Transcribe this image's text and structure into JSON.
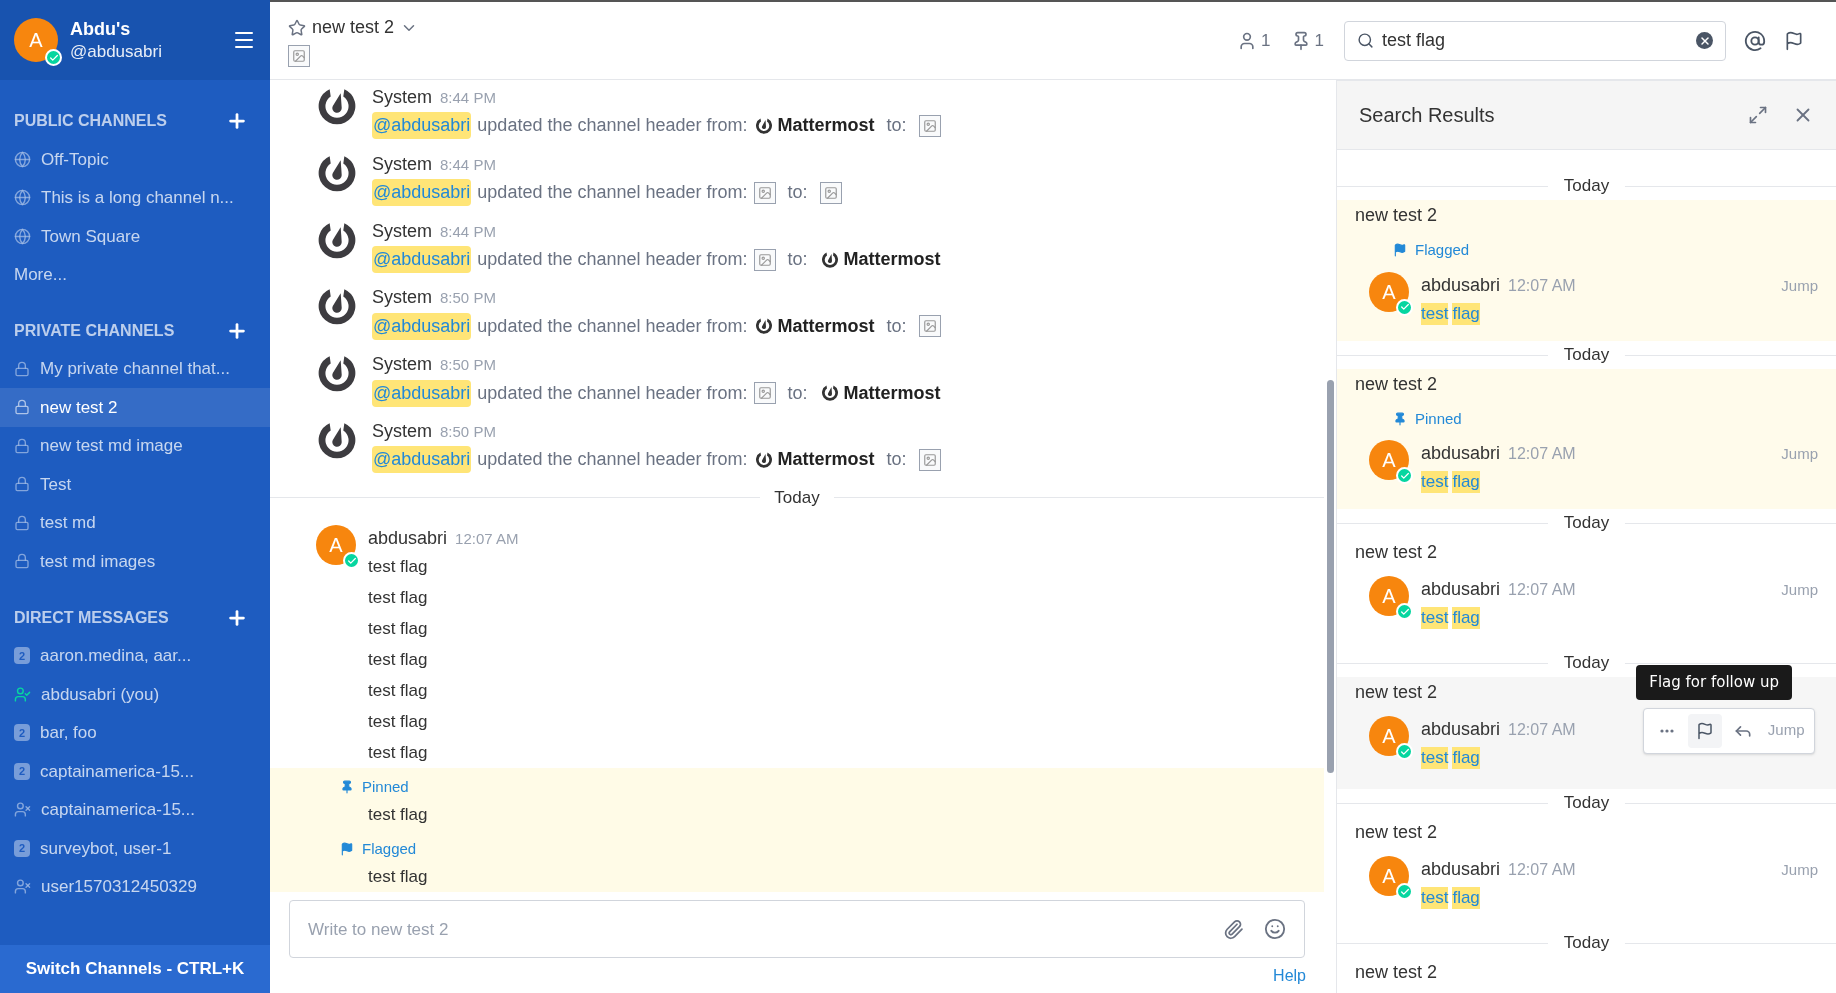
{
  "sidebar": {
    "avatar": "A",
    "name": "Abdu's",
    "username": "@abdusabri",
    "sections": [
      {
        "title": "PUBLIC CHANNELS",
        "more": "More...",
        "items": [
          {
            "kind": "public",
            "label": "Off-Topic",
            "selected": false
          },
          {
            "kind": "public",
            "label": "This is a long channel n...",
            "selected": false
          },
          {
            "kind": "public",
            "label": "Town Square",
            "selected": false
          }
        ]
      },
      {
        "title": "PRIVATE CHANNELS",
        "items": [
          {
            "kind": "private",
            "label": "My private channel that...",
            "selected": false
          },
          {
            "kind": "private",
            "label": "new test 2",
            "selected": true
          },
          {
            "kind": "private",
            "label": "new test md image",
            "selected": false
          },
          {
            "kind": "private",
            "label": "Test",
            "selected": false
          },
          {
            "kind": "private",
            "label": "test md",
            "selected": false
          },
          {
            "kind": "private",
            "label": "test md images",
            "selected": false
          }
        ]
      },
      {
        "title": "DIRECT MESSAGES",
        "items": [
          {
            "kind": "group",
            "badge": "2",
            "label": "aaron.medina, aar...",
            "selected": false
          },
          {
            "kind": "online",
            "label": "abdusabri (you)",
            "selected": false
          },
          {
            "kind": "group",
            "badge": "2",
            "label": "bar, foo",
            "selected": false
          },
          {
            "kind": "group",
            "badge": "2",
            "label": "captainamerica-15...",
            "selected": false
          },
          {
            "kind": "offline",
            "label": "captainamerica-15...",
            "selected": false
          },
          {
            "kind": "group",
            "badge": "2",
            "label": "surveybot, user-1",
            "selected": false
          },
          {
            "kind": "offline",
            "label": "user1570312450329",
            "selected": false
          }
        ]
      }
    ],
    "switch": "Switch Channels - CTRL+K"
  },
  "header": {
    "channel": "new test 2",
    "favorite": false,
    "members": "1",
    "pinned": "1",
    "search": "test flag"
  },
  "system_messages": [
    {
      "author": "System",
      "time": "8:44 PM",
      "mention": "@abdusabri",
      "text": "updated the channel header from:",
      "from": {
        "kind": "logo",
        "label": "Mattermost"
      },
      "connector": "to:",
      "to": {
        "kind": "image"
      }
    },
    {
      "author": "System",
      "time": "8:44 PM",
      "mention": "@abdusabri",
      "text": "updated the channel header from:",
      "from": {
        "kind": "image"
      },
      "connector": "to:",
      "to": {
        "kind": "image"
      }
    },
    {
      "author": "System",
      "time": "8:44 PM",
      "mention": "@abdusabri",
      "text": "updated the channel header from:",
      "from": {
        "kind": "image"
      },
      "connector": "to:",
      "to": {
        "kind": "logo",
        "label": "Mattermost"
      }
    },
    {
      "author": "System",
      "time": "8:50 PM",
      "mention": "@abdusabri",
      "text": "updated the channel header from:",
      "from": {
        "kind": "logo",
        "label": "Mattermost"
      },
      "connector": "to:",
      "to": {
        "kind": "image"
      }
    },
    {
      "author": "System",
      "time": "8:50 PM",
      "mention": "@abdusabri",
      "text": "updated the channel header from:",
      "from": {
        "kind": "image"
      },
      "connector": "to:",
      "to": {
        "kind": "logo",
        "label": "Mattermost"
      }
    },
    {
      "author": "System",
      "time": "8:50 PM",
      "mention": "@abdusabri",
      "text": "updated the channel header from:",
      "from": {
        "kind": "logo",
        "label": "Mattermost"
      },
      "connector": "to:",
      "to": {
        "kind": "image"
      }
    }
  ],
  "date_separator": "Today",
  "post": {
    "avatar": "A",
    "author": "abdusabri",
    "time": "12:07 AM",
    "lines": [
      {
        "text": "test flag",
        "highlighted": false
      },
      {
        "text": "test flag",
        "highlighted": false
      },
      {
        "text": "test flag",
        "highlighted": false
      },
      {
        "text": "test flag",
        "highlighted": false
      },
      {
        "text": "test flag",
        "highlighted": false
      },
      {
        "text": "test flag",
        "highlighted": false
      },
      {
        "text": "test flag",
        "highlighted": false
      },
      {
        "text": "test flag",
        "highlighted": true,
        "label": {
          "kind": "pinned",
          "text": "Pinned"
        }
      },
      {
        "text": "test flag",
        "highlighted": true,
        "label": {
          "kind": "flagged",
          "text": "Flagged"
        }
      }
    ]
  },
  "composer": {
    "placeholder": "Write to new test 2",
    "help": "Help"
  },
  "search_results": {
    "title": "Search Results",
    "results": [
      {
        "date": "Today",
        "channel": "new test 2",
        "highlighted": true,
        "hovered": false,
        "label": {
          "kind": "flagged",
          "text": "Flagged"
        },
        "avatar": "A",
        "author": "abdusabri",
        "time": "12:07 AM",
        "words": [
          "test",
          "flag"
        ],
        "jump": "Jump"
      },
      {
        "date": "Today",
        "channel": "new test 2",
        "highlighted": true,
        "hovered": false,
        "label": {
          "kind": "pinned",
          "text": "Pinned"
        },
        "avatar": "A",
        "author": "abdusabri",
        "time": "12:07 AM",
        "words": [
          "test",
          "flag"
        ],
        "jump": "Jump"
      },
      {
        "date": "Today",
        "channel": "new test 2",
        "highlighted": false,
        "hovered": false,
        "avatar": "A",
        "author": "abdusabri",
        "time": "12:07 AM",
        "words": [
          "test",
          "flag"
        ],
        "jump": "Jump"
      },
      {
        "date": "Today",
        "channel": "new test 2",
        "highlighted": false,
        "hovered": true,
        "tooltip": "Flag for follow up",
        "avatar": "A",
        "author": "abdusabri",
        "time": "12:07 AM",
        "words": [
          "test",
          "flag"
        ],
        "jump": "Jump"
      },
      {
        "date": "Today",
        "channel": "new test 2",
        "highlighted": false,
        "hovered": false,
        "avatar": "A",
        "author": "abdusabri",
        "time": "12:07 AM",
        "words": [
          "test",
          "flag"
        ],
        "jump": "Jump"
      },
      {
        "date": "Today",
        "channel": "new test 2",
        "highlighted": false,
        "hovered": false
      }
    ]
  }
}
